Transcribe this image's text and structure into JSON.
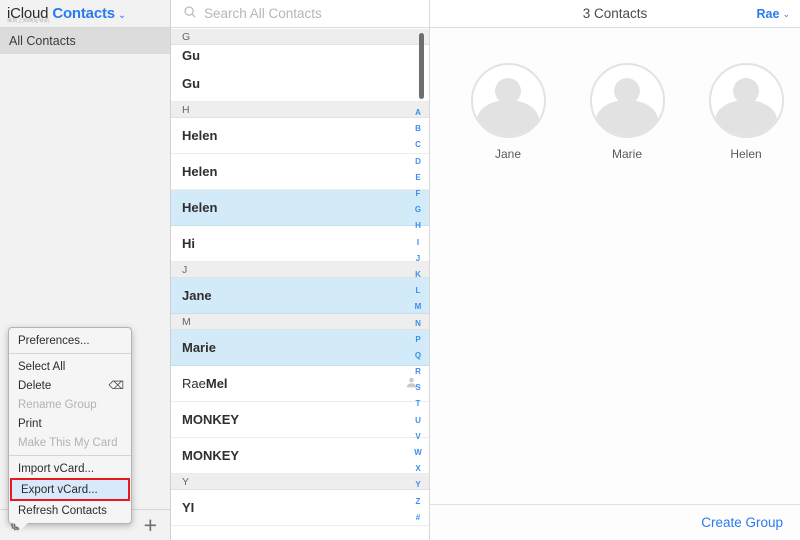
{
  "sidebar": {
    "brand_primary": "iCloud",
    "brand_secondary": "Contacts",
    "brand_caret": "⌄",
    "watermark": "清风上网网址导航",
    "group_label": "All Contacts",
    "gear_icon_name": "gear-icon",
    "add_label": "+"
  },
  "context_menu": {
    "items": [
      {
        "label": "Preferences...",
        "disabled": false,
        "shortcut": "",
        "highlighted": false,
        "separator_after": true
      },
      {
        "label": "Select All",
        "disabled": false,
        "shortcut": "",
        "highlighted": false,
        "separator_after": false
      },
      {
        "label": "Delete",
        "disabled": false,
        "shortcut": "⌫",
        "highlighted": false,
        "separator_after": false
      },
      {
        "label": "Rename Group",
        "disabled": true,
        "shortcut": "",
        "highlighted": false,
        "separator_after": false
      },
      {
        "label": "Print",
        "disabled": false,
        "shortcut": "",
        "highlighted": false,
        "separator_after": false
      },
      {
        "label": "Make This My Card",
        "disabled": true,
        "shortcut": "",
        "highlighted": false,
        "separator_after": true
      },
      {
        "label": "Import vCard...",
        "disabled": false,
        "shortcut": "",
        "highlighted": false,
        "separator_after": false
      },
      {
        "label": "Export vCard...",
        "disabled": false,
        "shortcut": "",
        "highlighted": true,
        "separator_after": false
      },
      {
        "label": "Refresh Contacts",
        "disabled": false,
        "shortcut": "",
        "highlighted": false,
        "separator_after": false
      }
    ],
    "annotation_color": "#e8191e",
    "highlight_color": "#d7e9fa"
  },
  "search": {
    "placeholder": "Search All Contacts",
    "value": "",
    "icon_name": "search-icon"
  },
  "contact_list": {
    "rows": [
      {
        "type": "section",
        "label": "G"
      },
      {
        "type": "contact",
        "first": "Gu",
        "last": "",
        "selected": false,
        "compact": true,
        "my_card": false
      },
      {
        "type": "contact",
        "first": "Gu",
        "last": "",
        "selected": false,
        "compact": false,
        "my_card": false
      },
      {
        "type": "section",
        "label": "H"
      },
      {
        "type": "contact",
        "first": "Helen",
        "last": "",
        "selected": false,
        "compact": false,
        "my_card": false
      },
      {
        "type": "contact",
        "first": "Helen",
        "last": "",
        "selected": false,
        "compact": false,
        "my_card": false
      },
      {
        "type": "contact",
        "first": "Helen",
        "last": "",
        "selected": true,
        "compact": false,
        "my_card": false
      },
      {
        "type": "contact",
        "first": "Hi",
        "last": "",
        "selected": false,
        "compact": false,
        "my_card": false
      },
      {
        "type": "section",
        "label": "J"
      },
      {
        "type": "contact",
        "first": "Jane",
        "last": "",
        "selected": true,
        "compact": false,
        "my_card": false
      },
      {
        "type": "section",
        "label": "M"
      },
      {
        "type": "contact",
        "first": "Marie",
        "last": "",
        "selected": true,
        "compact": false,
        "my_card": false
      },
      {
        "type": "contact",
        "first": "Rae ",
        "last": "Mel",
        "selected": false,
        "compact": false,
        "my_card": true
      },
      {
        "type": "contact",
        "first": "MONKEY",
        "last": "",
        "selected": false,
        "compact": false,
        "my_card": false
      },
      {
        "type": "contact",
        "first": "MONKEY",
        "last": "",
        "selected": false,
        "compact": false,
        "my_card": false
      },
      {
        "type": "section",
        "label": "Y"
      },
      {
        "type": "contact",
        "first": "YI",
        "last": "",
        "selected": false,
        "compact": false,
        "my_card": false
      }
    ],
    "alpha_index": [
      "A",
      "B",
      "C",
      "D",
      "E",
      "F",
      "G",
      "H",
      "I",
      "J",
      "K",
      "L",
      "M",
      "N",
      "P",
      "Q",
      "R",
      "S",
      "T",
      "U",
      "V",
      "W",
      "X",
      "Y",
      "Z",
      "#"
    ],
    "selected_row_color": "#d3eaf8"
  },
  "detail": {
    "title": "3 Contacts",
    "account_name": "Rae",
    "account_caret": "⌄",
    "contacts": [
      {
        "name": "Jane"
      },
      {
        "name": "Marie"
      },
      {
        "name": "Helen"
      }
    ],
    "create_group_label": "Create Group",
    "accent_color": "#2a7bf0"
  }
}
